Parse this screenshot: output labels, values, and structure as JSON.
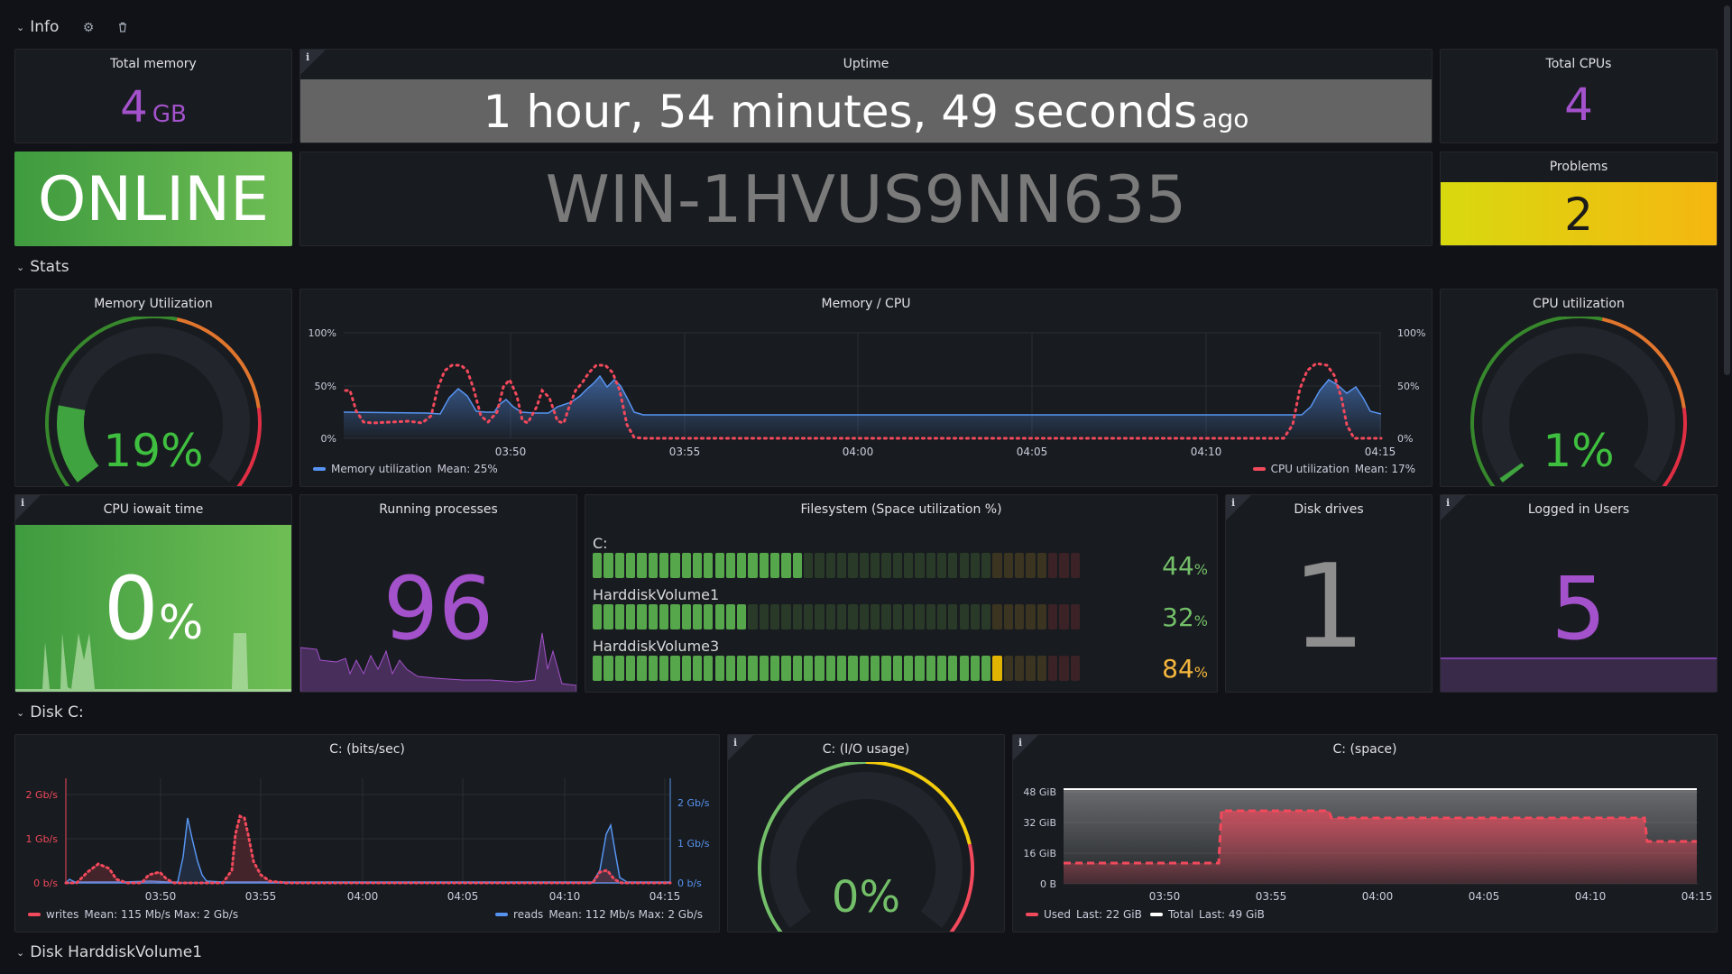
{
  "rows": {
    "info": "Info",
    "stats": "Stats",
    "disk_c": "Disk C:",
    "disk_hv1": "Disk HarddiskVolume1"
  },
  "icons": {
    "settings": "gear-icon",
    "delete": "trash-icon",
    "info": "info-icon",
    "chevron": "chevron-down-icon"
  },
  "info": {
    "total_memory": {
      "title": "Total memory",
      "value": "4",
      "unit": "GB"
    },
    "uptime": {
      "title": "Uptime",
      "value": "1 hour, 54 minutes, 49 seconds",
      "suffix": "ago"
    },
    "total_cpus": {
      "title": "Total CPUs",
      "value": "4"
    },
    "status": {
      "value": "ONLINE"
    },
    "hostname": {
      "value": "WIN-1HVUS9NN635"
    },
    "problems": {
      "title": "Problems",
      "value": "2"
    }
  },
  "stats": {
    "memory_utilization": {
      "title": "Memory Utilization",
      "value": "19",
      "unit": "%",
      "fraction": 0.19
    },
    "memory_cpu": {
      "title": "Memory / CPU",
      "left_ticks": [
        "100%",
        "50%",
        "0%"
      ],
      "right_ticks": [
        "100%",
        "50%",
        "0%"
      ],
      "x_ticks": [
        "03:50",
        "03:55",
        "04:00",
        "04:05",
        "04:10",
        "04:15"
      ],
      "legend_left": {
        "name": "Memory utilization",
        "stat": "Mean: 25%"
      },
      "legend_right": {
        "name": "CPU utilization",
        "stat": "Mean: 17%"
      }
    },
    "cpu_utilization": {
      "title": "CPU utilization",
      "value": "1",
      "unit": "%",
      "fraction": 0.01
    },
    "cpu_iowait": {
      "title": "CPU iowait time",
      "value": "0",
      "unit": "%"
    },
    "running_processes": {
      "title": "Running processes",
      "value": "96"
    },
    "filesystem": {
      "title": "Filesystem (Space utilization %)",
      "items": [
        {
          "name": "C:",
          "value": "44",
          "unit": "%",
          "fraction": 0.44
        },
        {
          "name": "HarddiskVolume1",
          "value": "32",
          "unit": "%",
          "fraction": 0.32
        },
        {
          "name": "HarddiskVolume3",
          "value": "84",
          "unit": "%",
          "fraction": 0.84
        }
      ]
    },
    "disk_drives": {
      "title": "Disk drives",
      "value": "1"
    },
    "logged_in_users": {
      "title": "Logged in Users",
      "value": "5"
    }
  },
  "disk_c": {
    "bits": {
      "title": "C: (bits/sec)",
      "left_ticks": [
        "2 Gb/s",
        "1 Gb/s",
        "0 b/s"
      ],
      "right_ticks": [
        "2 Gb/s",
        "1 Gb/s",
        "0 b/s"
      ],
      "x_ticks": [
        "03:50",
        "03:55",
        "04:00",
        "04:05",
        "04:10",
        "04:15"
      ],
      "legend_left": {
        "name": "writes",
        "stat": "Mean: 115 Mb/s   Max: 2 Gb/s"
      },
      "legend_right": {
        "name": "reads",
        "stat": "Mean: 112 Mb/s   Max: 2 Gb/s"
      }
    },
    "io": {
      "title": "C: (I/O usage)",
      "value": "0",
      "unit": "%",
      "fraction": 0.0
    },
    "space": {
      "title": "C: (space)",
      "y_ticks": [
        "48 GiB",
        "32 GiB",
        "16 GiB",
        "0 B"
      ],
      "x_ticks": [
        "03:50",
        "03:55",
        "04:00",
        "04:05",
        "04:10",
        "04:15"
      ],
      "legend": [
        {
          "name": "Used",
          "stat": "Last: 22 GiB"
        },
        {
          "name": "Total",
          "stat": "Last: 49 GiB"
        }
      ]
    }
  },
  "colors": {
    "purple": "#a352cc",
    "green": "#56a64b",
    "green_bright": "#73bf69",
    "red": "#f2495c",
    "blue": "#5794f2",
    "yellow": "#fade2a",
    "orange": "#ff780a"
  }
}
